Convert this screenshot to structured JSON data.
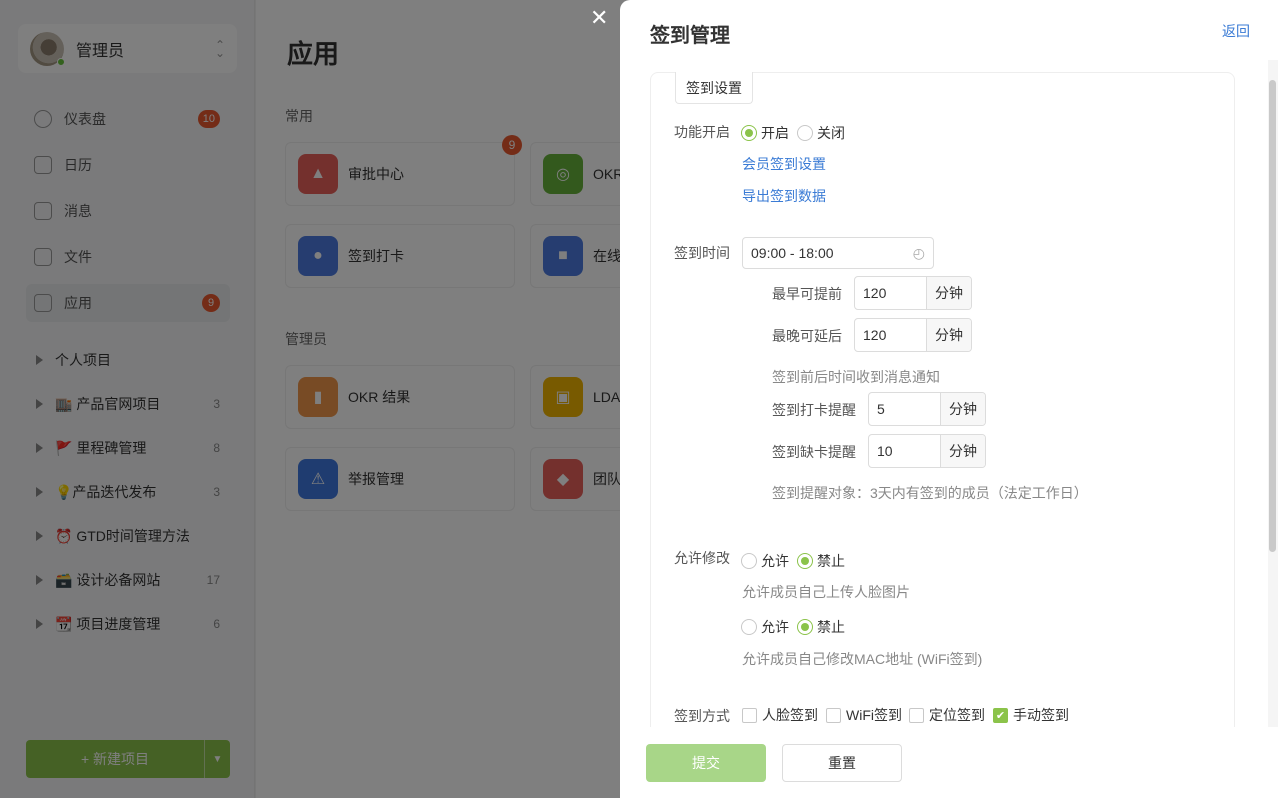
{
  "background": {
    "user": {
      "name": "管理员"
    },
    "menu": [
      {
        "label": "仪表盘",
        "badge": "10"
      },
      {
        "label": "日历",
        "badge": ""
      },
      {
        "label": "消息",
        "badge": ""
      },
      {
        "label": "文件",
        "badge": ""
      },
      {
        "label": "应用",
        "badge": "9"
      }
    ],
    "projects": [
      {
        "label": "个人项目",
        "count": ""
      },
      {
        "label": "🏬 产品官网项目",
        "count": "3"
      },
      {
        "label": "🚩 里程碑管理",
        "count": "8"
      },
      {
        "label": "💡产品迭代发布",
        "count": "3"
      },
      {
        "label": "⏰ GTD时间管理方法",
        "count": ""
      },
      {
        "label": "🗃️ 设计必备网站",
        "count": "17"
      },
      {
        "label": "📆 项目进度管理",
        "count": "6"
      }
    ],
    "new_project": {
      "label": "+  新建项目"
    },
    "page_title": "应用",
    "sections": {
      "common": "常用",
      "admin": "管理员"
    },
    "apps": {
      "approval": {
        "label": "审批中心",
        "badge": "9"
      },
      "okr": {
        "label": "OKR"
      },
      "checkin": {
        "label": "签到打卡"
      },
      "online": {
        "label": "在线"
      },
      "okr_result": {
        "label": "OKR 结果"
      },
      "ldap": {
        "label": "LDA"
      },
      "report": {
        "label": "举报管理"
      },
      "team": {
        "label": "团队"
      }
    }
  },
  "drawer": {
    "title": "签到管理",
    "back": "返回",
    "tab": "签到设置",
    "feature": {
      "label": "功能开启",
      "on": "开启",
      "off": "关闭",
      "selected": "on",
      "link_member": "会员签到设置",
      "link_export": "导出签到数据"
    },
    "time": {
      "label": "签到时间",
      "value": "09:00 - 18:00",
      "earliest_label": "最早可提前",
      "earliest_value": "120",
      "latest_label": "最晚可延后",
      "latest_value": "120",
      "unit": "分钟",
      "notify_hint": "签到前后时间收到消息通知",
      "remind_label": "签到打卡提醒",
      "remind_value": "5",
      "miss_label": "签到缺卡提醒",
      "miss_value": "10",
      "target_hint": "签到提醒对象：3天内有签到的成员（法定工作日）"
    },
    "modify": {
      "label": "允许修改",
      "allow": "允许",
      "forbid": "禁止",
      "face_hint": "允许成员自己上传人脸图片",
      "mac_hint": "允许成员自己修改MAC地址 (WiFi签到)"
    },
    "methods": {
      "label": "签到方式",
      "face": "人脸签到",
      "wifi": "WiFi签到",
      "location": "定位签到",
      "manual": "手动签到",
      "checked": [
        "manual"
      ]
    },
    "footer": {
      "submit": "提交",
      "reset": "重置"
    },
    "colors": {
      "accent": "#8bc34a",
      "link": "#3a7bd5",
      "submit_disabled": "#a8d688"
    }
  }
}
